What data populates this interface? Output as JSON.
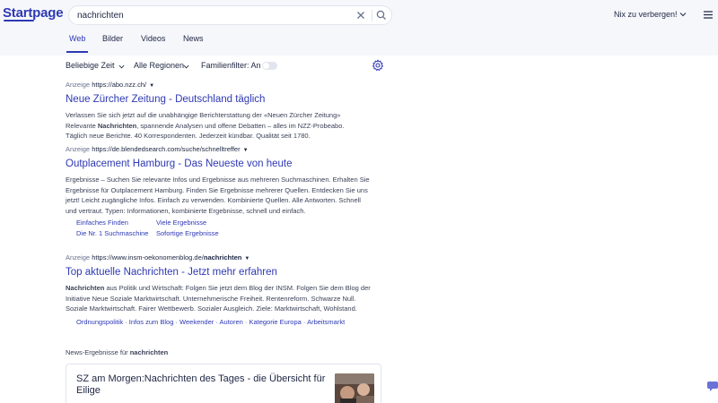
{
  "header": {
    "logo": "Startpage",
    "search": {
      "value": "nachrichten"
    },
    "privacy_label": "Nix zu verbergen!"
  },
  "tabs": [
    "Web",
    "Bilder",
    "Videos",
    "News"
  ],
  "filters": {
    "time": "Beliebige Zeit",
    "region": "Alle Regionen",
    "family": "Familienfilter: An"
  },
  "results": [
    {
      "ad_label": "Anzeige",
      "url": "https://abo.nzz.ch/",
      "title": "Neue Zürcher Zeitung - Deutschland täglich",
      "desc_1": "Verlassen Sie sich jetzt auf die unabhängige Berichterstattung der «Neuen Zürcher Zeitung»",
      "desc_2a": "Relevante ",
      "desc_2b": "Nachrichten",
      "desc_2c": ", spannende Analysen und offene Debatten – alles im NZZ-Probeabo.",
      "desc_3": "Täglich neue Berichte. 40 Korrespondenten. Jederzeit kündbar. Qualität seit 1780."
    },
    {
      "ad_label": "Anzeige",
      "url": "https://de.blendedsearch.com/suche/schnelltreffer",
      "title": "Outplacement Hamburg - Das Neueste von heute",
      "desc": "Ergebnisse – Suchen Sie relevante Infos und Ergebnisse aus mehreren Suchmaschinen. Erhalten Sie Ergebnisse für Outplacement Hamburg. Finden Sie Ergebnisse mehrerer Quellen. Entdecken Sie uns jetzt! Leicht zugängliche Infos. Einfach zu verwenden. Kombinierte Quellen. Alle Antworten. Schnell und vertraut. Typen: Informationen, kombinierte Ergebnisse, schnell und einfach.",
      "sitelinks": [
        "Einfaches Finden",
        "Viele Ergebnisse",
        "Die Nr. 1 Suchmaschine",
        "Sofortige Ergebnisse"
      ]
    },
    {
      "ad_label": "Anzeige",
      "url_prefix": "https://www.insm-oekonomenblog.de/",
      "url_bold": "nachrichten",
      "title_a": "Top aktuelle ",
      "title_b": "Nachrichten",
      "title_c": " - Jetzt mehr erfahren",
      "desc_bold": "Nachrichten",
      "desc": " aus Politik und Wirtschaft: Folgen Sie jetzt dem Blog der INSM. Folgen Sie dem Blog der Initiative Neue Soziale Marktwirtschaft. Unternehmerische Freiheit. Rentenreform. Schwarze Null. Soziale Marktwirtschaft. Fairer Wettbewerb. Sozialer Ausgleich. Ziele: Marktwirtschaft, Wohlstand.",
      "links": "Ordnungspolitik · Infos zum Blog · Weekender · Autoren · Kategorie Europa · Arbeitsmarkt"
    }
  ],
  "news": {
    "heading_prefix": "News-Ergebnisse für ",
    "heading_query": "nachrichten",
    "card_title": "SZ am Morgen:Nachrichten des Tages - die Übersicht für Eilige"
  },
  "icons": {
    "clear": "close-icon",
    "search": "search-icon",
    "settings": "gear-icon",
    "menu": "hamburger-menu-icon",
    "chat": "chat-icon"
  },
  "colors": {
    "accent": "#2e39b3",
    "header_bg": "#f6f7fb",
    "text": "#202945"
  }
}
